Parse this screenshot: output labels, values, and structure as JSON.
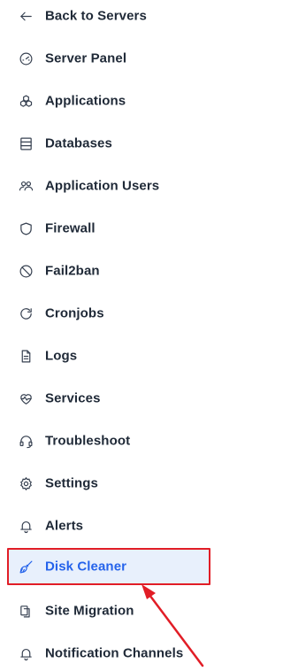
{
  "nav": {
    "back": "Back to Servers",
    "items": [
      {
        "label": "Server Panel",
        "icon": "gauge-icon"
      },
      {
        "label": "Applications",
        "icon": "cubes-icon"
      },
      {
        "label": "Databases",
        "icon": "database-icon"
      },
      {
        "label": "Application Users",
        "icon": "users-icon"
      },
      {
        "label": "Firewall",
        "icon": "shield-icon"
      },
      {
        "label": "Fail2ban",
        "icon": "ban-icon"
      },
      {
        "label": "Cronjobs",
        "icon": "refresh-icon"
      },
      {
        "label": "Logs",
        "icon": "file-text-icon"
      },
      {
        "label": "Services",
        "icon": "heartbeat-icon"
      },
      {
        "label": "Troubleshoot",
        "icon": "headset-icon"
      },
      {
        "label": "Settings",
        "icon": "gear-icon"
      },
      {
        "label": "Alerts",
        "icon": "bell-icon"
      },
      {
        "label": "Disk Cleaner",
        "icon": "broom-icon",
        "active": true
      },
      {
        "label": "Site Migration",
        "icon": "copy-icon"
      },
      {
        "label": "Notification Channels",
        "icon": "bell-icon"
      }
    ]
  },
  "colors": {
    "active_text": "#2563eb",
    "active_bg": "#e8f0fc",
    "highlight_border": "#e11d26",
    "annotation_arrow": "#e11d26"
  }
}
